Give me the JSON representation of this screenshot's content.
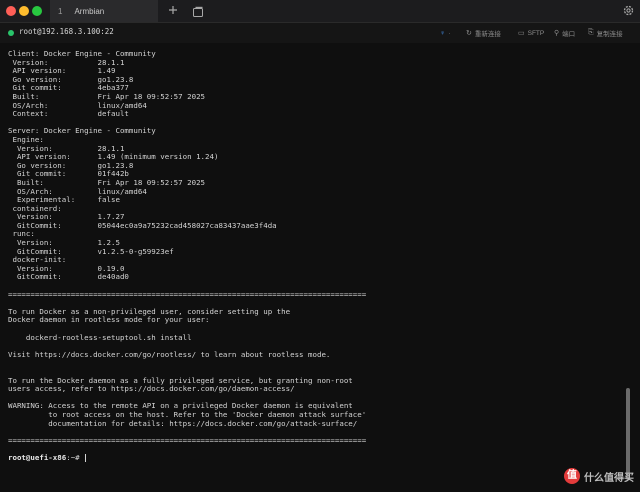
{
  "window": {
    "tab_number": "1",
    "tab_title": "Armbian"
  },
  "session": {
    "host": "root@192.168.3.100:22",
    "toolbar": [
      {
        "icon": "lightbulb-icon",
        "label": "·"
      },
      {
        "icon": "refresh-icon",
        "label": "重新连接"
      },
      {
        "icon": "folder-icon",
        "label": "SFTP"
      },
      {
        "icon": "plug-icon",
        "label": "端口"
      },
      {
        "icon": "link-icon",
        "label": "复制连接"
      }
    ]
  },
  "terminal": {
    "lines": [
      "Client: Docker Engine - Community",
      " Version:           28.1.1",
      " API version:       1.49",
      " Go version:        go1.23.8",
      " Git commit:        4eba377",
      " Built:             Fri Apr 18 09:52:57 2025",
      " OS/Arch:           linux/amd64",
      " Context:           default",
      "",
      "Server: Docker Engine - Community",
      " Engine:",
      "  Version:          28.1.1",
      "  API version:      1.49 (minimum version 1.24)",
      "  Go version:       go1.23.8",
      "  Git commit:       01f442b",
      "  Built:            Fri Apr 18 09:52:57 2025",
      "  OS/Arch:          linux/amd64",
      "  Experimental:     false",
      " containerd:",
      "  Version:          1.7.27",
      "  GitCommit:        05044ec0a9a75232cad458027ca83437aae3f4da",
      " runc:",
      "  Version:          1.2.5",
      "  GitCommit:        v1.2.5-0-g59923ef",
      " docker-init:",
      "  Version:          0.19.0",
      "  GitCommit:        de40ad0",
      "",
      "================================================================================",
      "",
      "To run Docker as a non-privileged user, consider setting up the",
      "Docker daemon in rootless mode for your user:",
      "",
      "    dockerd-rootless-setuptool.sh install",
      "",
      "Visit https://docs.docker.com/go/rootless/ to learn about rootless mode.",
      "",
      "",
      "To run the Docker daemon as a fully privileged service, but granting non-root",
      "users access, refer to https://docs.docker.com/go/daemon-access/",
      "",
      "WARNING: Access to the remote API on a privileged Docker daemon is equivalent",
      "         to root access on the host. Refer to the 'Docker daemon attack surface'",
      "         documentation for details: https://docs.docker.com/go/attack-surface/",
      "",
      "================================================================================",
      ""
    ],
    "prompt_user": "root@uefi-x86",
    "prompt_suffix": ":~# "
  },
  "watermark": {
    "badge": "值",
    "text": "什么值得买"
  }
}
